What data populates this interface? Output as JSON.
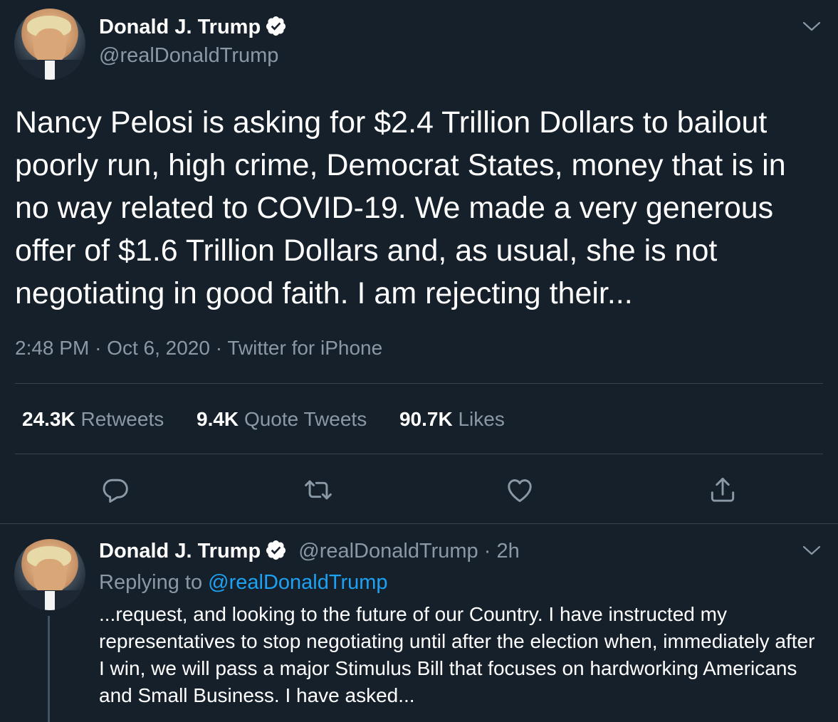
{
  "main_tweet": {
    "author_name": "Donald J. Trump",
    "author_handle": "@realDonaldTrump",
    "text": "Nancy Pelosi is asking for $2.4 Trillion Dollars to bailout poorly run, high crime, Democrat States, money that is in no way related to COVID-19. We made a very generous offer of $1.6 Trillion Dollars and, as usual, she is not negotiating in good faith. I am rejecting their...",
    "time": "2:48 PM",
    "date": "Oct 6, 2020",
    "source": "Twitter for iPhone",
    "stats": {
      "retweets_count": "24.3K",
      "retweets_label": "Retweets",
      "quotes_count": "9.4K",
      "quotes_label": "Quote Tweets",
      "likes_count": "90.7K",
      "likes_label": "Likes"
    },
    "actions": [
      "reply-icon",
      "retweet-icon",
      "like-icon",
      "share-icon"
    ]
  },
  "reply_tweet": {
    "author_name": "Donald J. Trump",
    "author_handle": "@realDonaldTrump",
    "age": "2h",
    "replying_label": "Replying to",
    "replying_handle": "@realDonaldTrump",
    "text": "...request, and looking to the future of our Country. I have instructed my representatives to stop negotiating until after the election when, immediately after I win, we will pass a major Stimulus Bill that focuses on hardworking Americans and Small Business. I have asked..."
  },
  "meta_separator": "·",
  "colors": {
    "background": "#15202b",
    "text": "#ffffff",
    "secondary": "#8b98a5",
    "divider": "#38444d",
    "link": "#1da1f2"
  }
}
